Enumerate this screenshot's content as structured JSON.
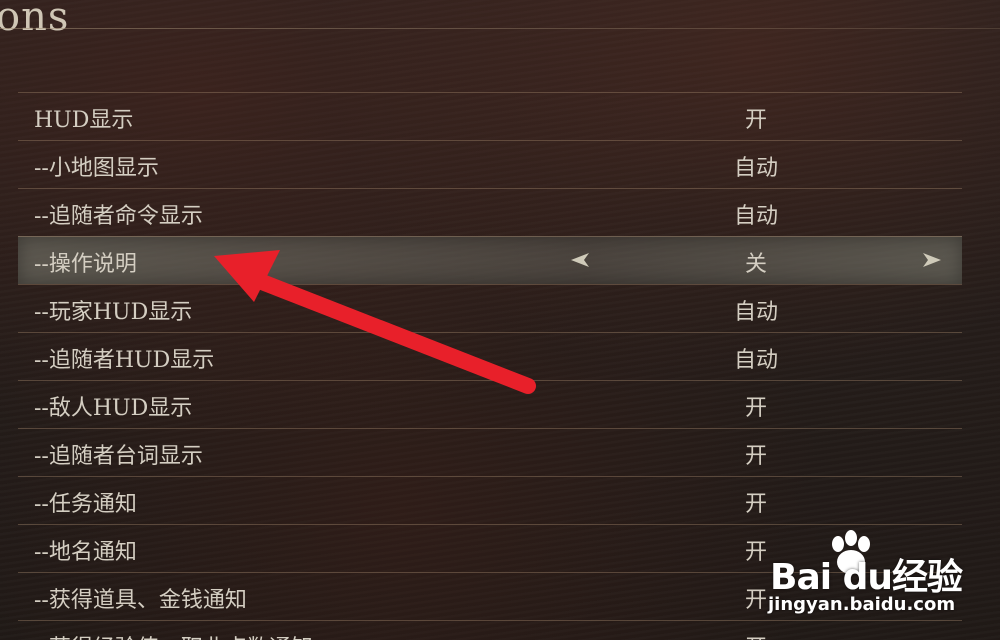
{
  "header": {
    "title": "ons"
  },
  "settings": [
    {
      "label": "HUD显示",
      "value": "开",
      "selected": false
    },
    {
      "label": "--小地图显示",
      "value": "自动",
      "selected": false
    },
    {
      "label": "--追随者命令显示",
      "value": "自动",
      "selected": false
    },
    {
      "label": "--操作说明",
      "value": "关",
      "selected": true
    },
    {
      "label": "--玩家HUD显示",
      "value": "自动",
      "selected": false
    },
    {
      "label": "--追随者HUD显示",
      "value": "自动",
      "selected": false
    },
    {
      "label": "--敌人HUD显示",
      "value": "开",
      "selected": false
    },
    {
      "label": "--追随者台词显示",
      "value": "开",
      "selected": false
    },
    {
      "label": "--任务通知",
      "value": "开",
      "selected": false
    },
    {
      "label": "--地名通知",
      "value": "开",
      "selected": false
    },
    {
      "label": "--获得道具、金钱通知",
      "value": "开",
      "selected": false
    },
    {
      "label": "--获得经验值、职业点数通知",
      "value": "开",
      "selected": false
    }
  ],
  "annotation": {
    "color": "#e8202a",
    "icon": "red-pointer-arrow-icon"
  },
  "watermark": {
    "brand": "Bai du",
    "suffix": "经验",
    "url": "jingyan.baidu.com"
  },
  "colors": {
    "text": "#d4cec2",
    "row_divider": "#967d64",
    "selected_row": "#6e6e64"
  }
}
